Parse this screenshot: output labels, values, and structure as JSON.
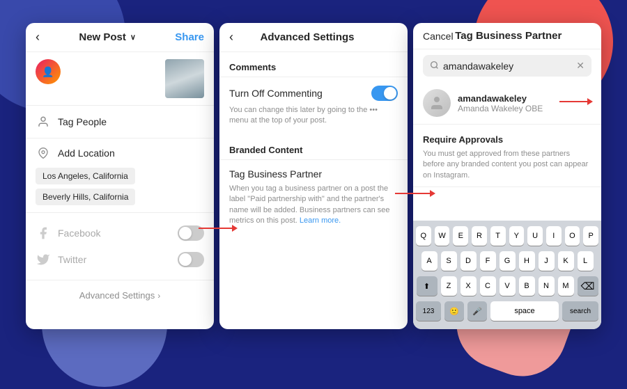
{
  "background": {
    "color": "#1a237e"
  },
  "screen1": {
    "header": {
      "back_label": "‹",
      "title": "New Post",
      "title_chevron": "∨",
      "share_label": "Share"
    },
    "tag_people_label": "Tag People",
    "add_location_label": "Add Location",
    "location_tags": [
      "Los Angeles, California",
      "Beverly Hills, California"
    ],
    "facebook_label": "Facebook",
    "twitter_label": "Twitter",
    "advanced_settings_label": "Advanced Settings",
    "advanced_chevron": "›"
  },
  "screen2": {
    "header": {
      "back_label": "‹",
      "title": "Advanced Settings"
    },
    "comments_section": "Comments",
    "turn_off_commenting_label": "Turn Off Commenting",
    "turn_off_commenting_desc": "You can change this later by going to the ••• menu at the top of your post.",
    "branded_content_section": "Branded Content",
    "tag_business_partner_label": "Tag Business Partner",
    "tag_business_partner_desc": "When you tag a business partner on a post the label \"Paid partnership with\" and the partner's name will be added. Business partners can see metrics on this post.",
    "learn_more": "Learn more."
  },
  "screen3": {
    "header": {
      "cancel_label": "Cancel",
      "title": "Tag Business Partner"
    },
    "search_placeholder": "amandawakeley",
    "result": {
      "username": "amandawakeley",
      "full_name": "Amanda Wakeley OBE"
    },
    "require_approvals_title": "Require Approvals",
    "require_approvals_desc": "You must get approved from these partners before any branded content you post can appear on Instagram.",
    "keyboard": {
      "row1": [
        "Q",
        "W",
        "E",
        "R",
        "T",
        "Y",
        "U",
        "I",
        "O",
        "P"
      ],
      "row2": [
        "A",
        "S",
        "D",
        "F",
        "G",
        "H",
        "J",
        "K",
        "L"
      ],
      "row3": [
        "Z",
        "X",
        "C",
        "V",
        "B",
        "N",
        "M"
      ],
      "num_label": "123",
      "space_label": "space",
      "search_label": "search"
    }
  }
}
